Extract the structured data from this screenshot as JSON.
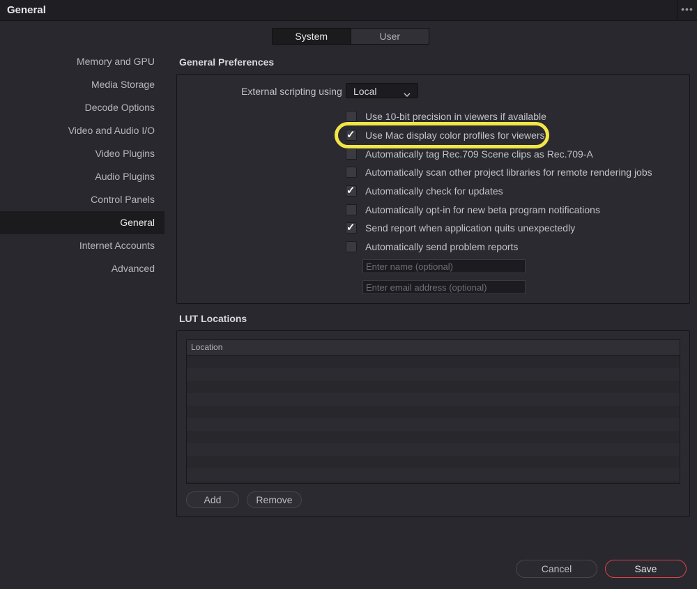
{
  "window": {
    "title": "General",
    "more_label": "•••"
  },
  "segmented": {
    "system": "System",
    "user": "User"
  },
  "sidebar": {
    "items": [
      {
        "label": "Memory and GPU"
      },
      {
        "label": "Media Storage"
      },
      {
        "label": "Decode Options"
      },
      {
        "label": "Video and Audio I/O"
      },
      {
        "label": "Video Plugins"
      },
      {
        "label": "Audio Plugins"
      },
      {
        "label": "Control Panels"
      },
      {
        "label": "General"
      },
      {
        "label": "Internet Accounts"
      },
      {
        "label": "Advanced"
      }
    ],
    "active_index": 7
  },
  "general_prefs": {
    "title": "General Preferences",
    "external_scripting_label": "External scripting using",
    "external_scripting_value": "Local",
    "checkboxes": [
      {
        "label": "Use 10-bit precision in viewers if available",
        "checked": false
      },
      {
        "label": "Use Mac display color profiles for viewers",
        "checked": true
      },
      {
        "label": "Automatically tag Rec.709 Scene clips as Rec.709-A",
        "checked": false
      },
      {
        "label": "Automatically scan other project libraries for remote rendering jobs",
        "checked": false
      },
      {
        "label": "Automatically check for updates",
        "checked": true
      },
      {
        "label": "Automatically opt-in for new beta program notifications",
        "checked": false
      },
      {
        "label": "Send report when application quits unexpectedly",
        "checked": true
      },
      {
        "label": "Automatically send problem reports",
        "checked": false
      }
    ],
    "name_placeholder": "Enter name (optional)",
    "email_placeholder": "Enter email address (optional)",
    "highlight_color": "#f2e547"
  },
  "lut": {
    "title": "LUT Locations",
    "column_header": "Location",
    "add_label": "Add",
    "remove_label": "Remove"
  },
  "footer": {
    "cancel_label": "Cancel",
    "save_label": "Save",
    "save_accent": "#e0404a"
  }
}
